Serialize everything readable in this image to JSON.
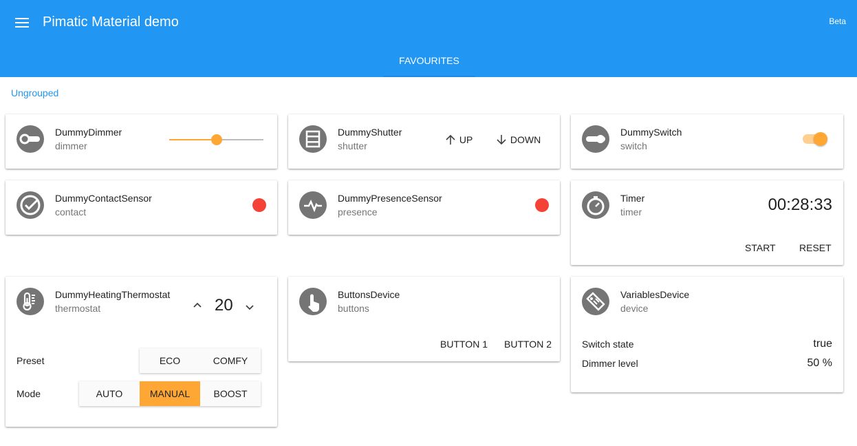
{
  "app": {
    "title": "Pimatic Material demo",
    "badge": "Beta",
    "tab": "FAVOURITES",
    "group": "Ungrouped"
  },
  "devices": {
    "dimmer": {
      "name": "DummyDimmer",
      "type": "dimmer",
      "level": 0.5,
      "icon": "dimmer-icon"
    },
    "shutter": {
      "name": "DummyShutter",
      "type": "shutter",
      "up": "UP",
      "down": "DOWN",
      "icon": "shutter-icon"
    },
    "switch": {
      "name": "DummySwitch",
      "type": "switch",
      "state": "on",
      "icon": "switch-icon"
    },
    "contact": {
      "name": "DummyContactSensor",
      "type": "contact",
      "icon": "contact-icon"
    },
    "presence": {
      "name": "DummyPresenceSensor",
      "type": "presence",
      "icon": "presence-icon"
    },
    "timer": {
      "name": "Timer",
      "type": "timer",
      "time": "00:28:33",
      "start": "START",
      "reset": "RESET",
      "icon": "timer-icon"
    },
    "thermostat": {
      "name": "DummyHeatingThermostat",
      "type": "thermostat",
      "value": "20",
      "preset_label": "Preset",
      "presets": [
        "ECO",
        "COMFY"
      ],
      "mode_label": "Mode",
      "modes": [
        "AUTO",
        "MANUAL",
        "BOOST"
      ],
      "active_mode": "MANUAL",
      "icon": "thermostat-icon"
    },
    "buttons": {
      "name": "ButtonsDevice",
      "type": "buttons",
      "button1": "BUTTON 1",
      "button2": "BUTTON 2",
      "icon": "touch-icon"
    },
    "variables": {
      "name": "VariablesDevice",
      "type": "device",
      "rows": [
        {
          "label": "Switch state",
          "value": "true"
        },
        {
          "label": "Dimmer level",
          "value": "50 %"
        }
      ],
      "icon": "tag-icon"
    }
  },
  "colors": {
    "primary": "#2196f3",
    "accent": "#ffa734",
    "alarm": "#f44336",
    "icon": "#757575"
  }
}
